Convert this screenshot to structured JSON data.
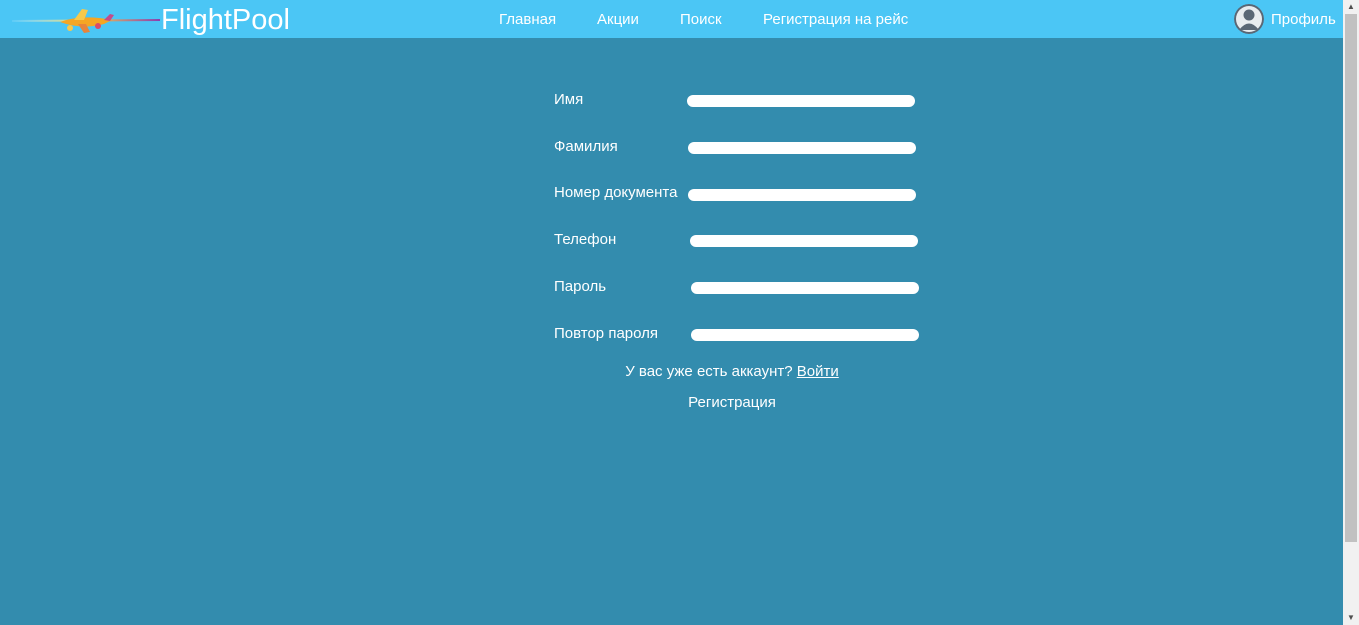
{
  "header": {
    "brand": "FlightPool",
    "nav": [
      "Главная",
      "Акции",
      "Поиск",
      "Регистрация на рейс"
    ],
    "profile_label": "Профиль",
    "background_color": "#4bc6f5"
  },
  "page": {
    "background_color": "#338cae"
  },
  "form": {
    "fields": [
      {
        "label": "Имя",
        "value": ""
      },
      {
        "label": "Фамилия",
        "value": ""
      },
      {
        "label": "Номер документа",
        "value": ""
      },
      {
        "label": "Телефон",
        "value": ""
      },
      {
        "label": "Пароль",
        "value": ""
      },
      {
        "label": "Повтор пароля",
        "value": ""
      }
    ],
    "account_prompt": "У вас уже есть аккаунт?",
    "login_link": "Войти",
    "submit_label": "Регистрация"
  },
  "icons": {
    "logo": "airplane-logo-icon",
    "avatar": "user-avatar-icon"
  }
}
